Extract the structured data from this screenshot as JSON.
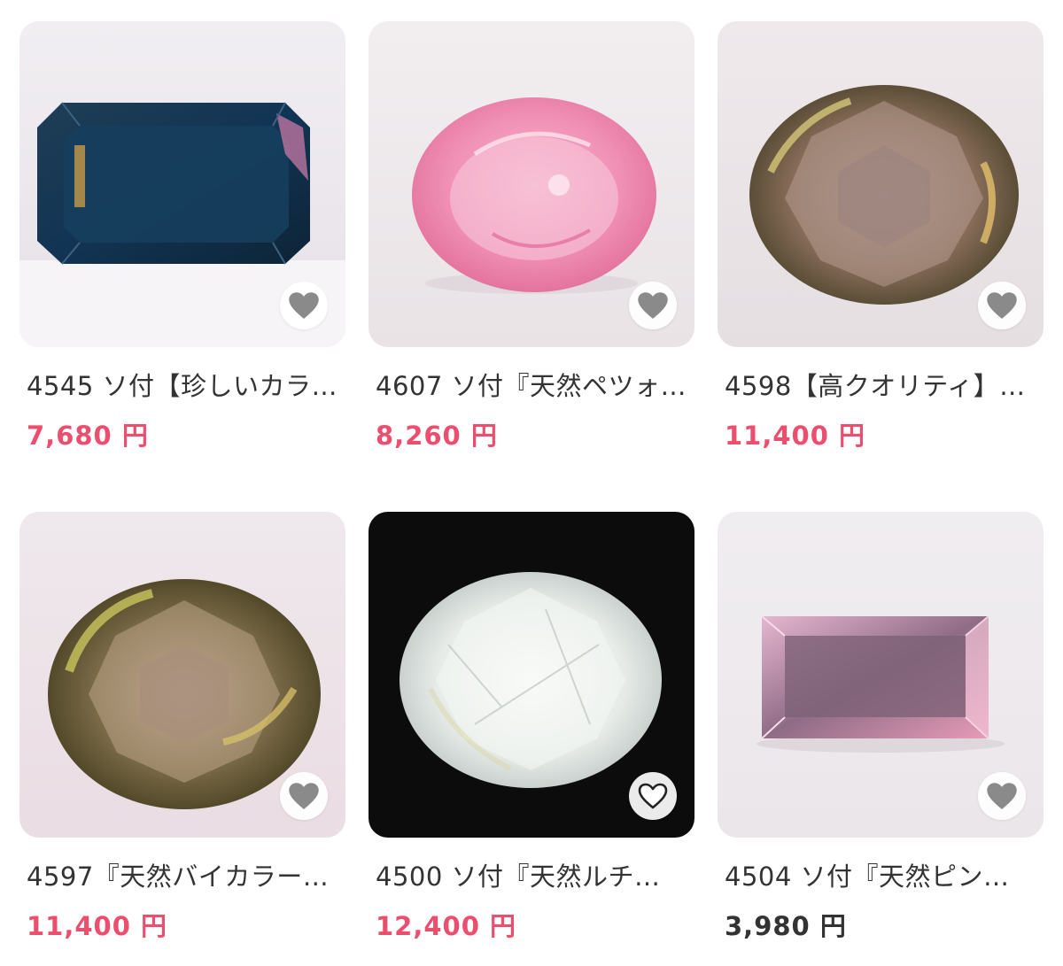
{
  "colors": {
    "price_accent": "#ec4e6e",
    "price_default": "#333333",
    "text": "#333333",
    "like_icon": "#8a8a8a",
    "like_icon_outline": "#222222"
  },
  "items": [
    {
      "title": "4545 ソ付【珍しいカラ…",
      "price": "7,680 円",
      "price_color": "#ec4e6e",
      "like_icon": "heart-filled-icon"
    },
    {
      "title": "4607 ソ付『天然ペツォ…",
      "price": "8,260 円",
      "price_color": "#ec4e6e",
      "like_icon": "heart-filled-icon"
    },
    {
      "title": "4598【高クオリティ】…",
      "price": "11,400 円",
      "price_color": "#ec4e6e",
      "like_icon": "heart-filled-icon"
    },
    {
      "title": "4597『天然バイカラー…",
      "price": "11,400 円",
      "price_color": "#ec4e6e",
      "like_icon": "heart-filled-icon"
    },
    {
      "title": "4500 ソ付『天然ルチ…",
      "price": "12,400 円",
      "price_color": "#ec4e6e",
      "like_icon": "heart-outline-icon"
    },
    {
      "title": "4504 ソ付『天然ピン…",
      "price": "3,980 円",
      "price_color": "#333333",
      "like_icon": "heart-filled-icon"
    }
  ]
}
